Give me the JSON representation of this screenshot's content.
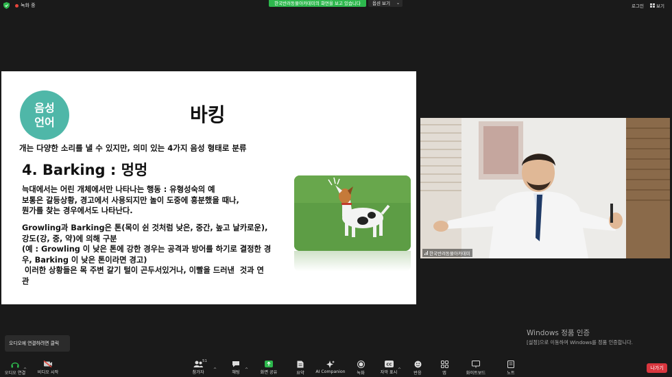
{
  "topbar": {
    "recording_label": "녹화 중",
    "share_banner": "한국반려동물아카데미의 화면을 보고 있습니다",
    "view_options": "옵션 보기",
    "login": "로그인",
    "view": "보기"
  },
  "slide": {
    "badge_line1": "음성",
    "badge_line2": "언어",
    "title": "바킹",
    "subtitle": "개는 다양한 소리를 낼 수 있지만, 의미 있는 4가지 음성 형태로  분류",
    "heading": "4. Barking  : 멍멍",
    "para1": [
      "늑대에서는 어린 개체에서만 나타나는 행동 : 유형성숙의 예",
      "보통은 갈등상황, 경고에서 사용되지만 놀이 도중에 흥분했을 때나,",
      "뭔가를 찾는 경우에서도 나타난다."
    ],
    "para2": [
      "Growling과 Barking은 톤(목이 쉰 것처럼 낮은, 중간, 높고 날카로운),",
      "강도(강, 중, 약)에 의해 구분",
      "(예 : Growling 이 낮은 톤에 강한 경우는 공격과 방어를 하기로 결정한 경",
      "우, Barking 이 낮은 톤이라면 경고)",
      " 이러한 상황들은 목 주변 갈기 털이 곤두서있거나, 이빨을 드러낸  것과 연",
      "관"
    ]
  },
  "camera": {
    "participant_name": "한국반려동물아카데미"
  },
  "windows_activation": {
    "title": "Windows 정품 인증",
    "message": "[설정]으로 이동하여 Windows를 정품 인증합니다."
  },
  "tooltip": "오디오에 연결하려면 클릭",
  "toolbar": {
    "audio": "오디오 연결",
    "video": "비디오 시작",
    "participants": "참가자",
    "participants_count": "51",
    "chat": "채팅",
    "share": "화면 공유",
    "summary": "요약",
    "ai": "AI Companion",
    "record": "녹화",
    "captions": "자막 표시",
    "reactions": "반응",
    "apps": "앱",
    "whiteboard": "화이트보드",
    "notes": "노트",
    "leave": "나가기"
  },
  "colors": {
    "badge": "#4fb7a8",
    "share_green": "#2db84d",
    "leave_red": "#d9363e"
  }
}
